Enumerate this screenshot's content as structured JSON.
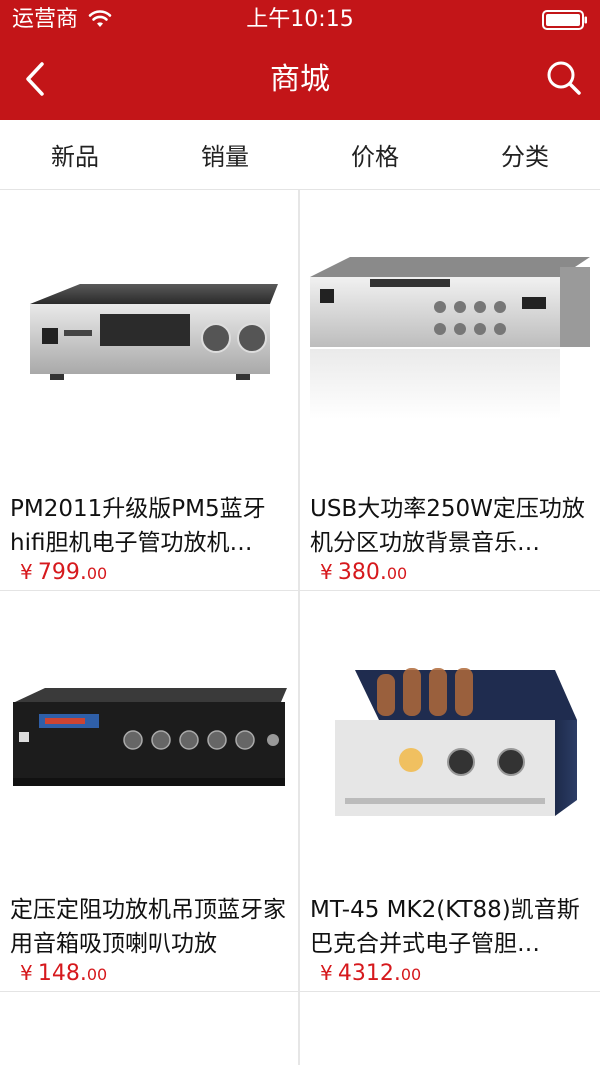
{
  "status_bar": {
    "carrier": "运营商",
    "time": "上午10:15"
  },
  "navbar": {
    "title": "商城",
    "back_icon": "chevron-left-icon",
    "search_icon": "search-icon"
  },
  "tabs": [
    {
      "label": "新品"
    },
    {
      "label": "销量"
    },
    {
      "label": "价格"
    },
    {
      "label": "分类"
    }
  ],
  "products": [
    {
      "title": "PM2011升级版PM5蓝牙hifi胆机电子管功放机…",
      "currency": "¥",
      "price_int": "799.",
      "price_dec": "00"
    },
    {
      "title": "USB大功率250W定压功放机分区功放背景音乐…",
      "currency": "¥",
      "price_int": "380.",
      "price_dec": "00"
    },
    {
      "title": "定压定阻功放机吊顶蓝牙家用音箱吸顶喇叭功放",
      "currency": "¥",
      "price_int": "148.",
      "price_dec": "00"
    },
    {
      "title": "MT-45 MK2(KT88)凯音斯巴克合并式电子管胆…",
      "currency": "¥",
      "price_int": "4312.",
      "price_dec": "00"
    }
  ],
  "colors": {
    "brand": "#c31518",
    "price": "#d6191d"
  }
}
